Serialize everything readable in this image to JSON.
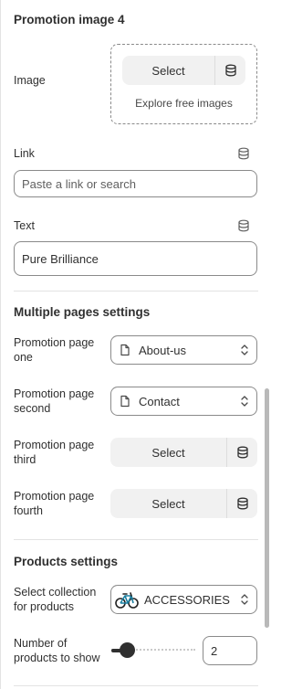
{
  "promotion_image_4": {
    "title": "Promotion image 4",
    "image_label": "Image",
    "select_label": "Select",
    "explore_label": "Explore free images",
    "link_label": "Link",
    "link_placeholder": "Paste a link or search",
    "text_label": "Text",
    "text_value": "Pure Brilliance"
  },
  "multiple_pages": {
    "title": "Multiple pages settings",
    "pages": [
      {
        "label_line1": "Promotion page",
        "label_line2": "one",
        "value": "About-us"
      },
      {
        "label_line1": "Promotion page",
        "label_line2": "second",
        "value": "Contact"
      },
      {
        "label_line1": "Promotion page",
        "label_line2": "third",
        "button": "Select"
      },
      {
        "label_line1": "Promotion page",
        "label_line2": "fourth",
        "button": "Select"
      }
    ]
  },
  "products_settings": {
    "title": "Products settings",
    "collection_label_line1": "Select collection",
    "collection_label_line2": "for products",
    "collection_value": "ACCESSORIES",
    "count_label_line1": "Number of",
    "count_label_line2": "products to show",
    "count_value": "2",
    "count_slider_fraction": 0.1
  },
  "icons": {
    "dynamic_source": "database-icon",
    "page": "page-icon",
    "chevron": "select-chevron-icon",
    "collection_thumb": "bicycle-icon"
  }
}
